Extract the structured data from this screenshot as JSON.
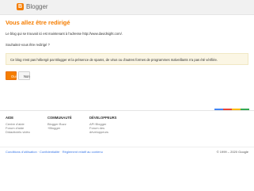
{
  "header": {
    "logo_letter": "B",
    "app_name": "Blogger"
  },
  "main": {
    "title": "Vous allez être redirigé",
    "line1": "Le blog qui se trouvait ici est maintenant à l'adresse http://www.davidsight.com/.",
    "line2": "Souhaitez-vous être redirigé ?",
    "notice": "Ce blog n'est pas hébergé par Blogger et la présence de spams, de virus ou d'autres formes de programmes malveillants n'a pas été vérifiée.",
    "yes_label": "Oui",
    "no_label": "Non"
  },
  "footer": {
    "columns": [
      {
        "heading": "AIDE",
        "links": [
          "Centre d'aide",
          "Forum d'aide",
          "Didacticiels vidéo"
        ]
      },
      {
        "heading": "COMMUNAUTÉ",
        "links": [
          "Blogger Buzz",
          "+Blogger"
        ]
      },
      {
        "heading": "DÉVELOPPEURS",
        "links": [
          "API Blogger",
          "Forum des",
          "développeurs"
        ]
      }
    ],
    "bottom_links": [
      "Conditions d'utilisation",
      "Confidentialité",
      "Règlement relatif au contenu"
    ],
    "copyright": "© 1999 – 2020 Google"
  },
  "colors": {
    "accent": "#f57d00",
    "stripe": [
      "#4285f4",
      "#ea4335",
      "#fbbc05",
      "#34a853"
    ]
  }
}
